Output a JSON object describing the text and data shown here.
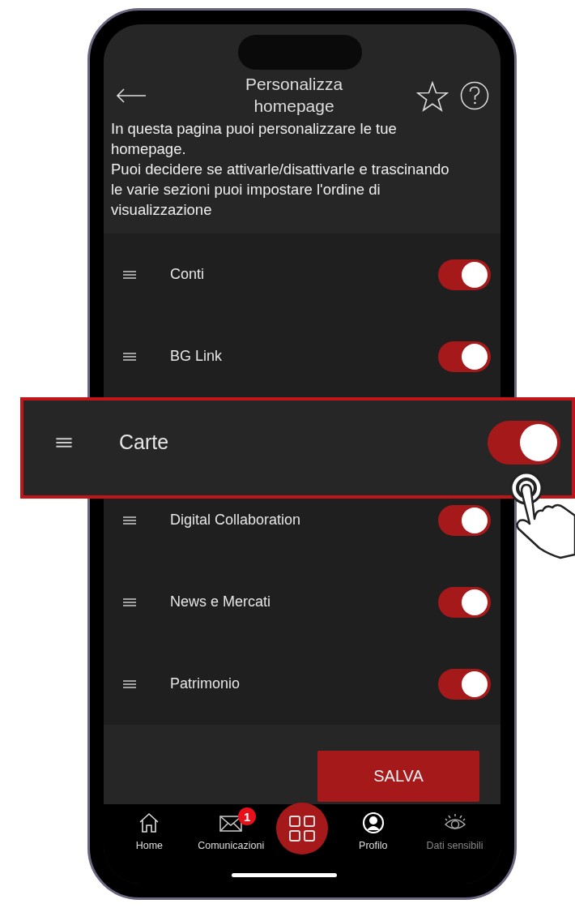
{
  "header": {
    "title": "Personalizza homepage",
    "description": "In questa pagina puoi personalizzare le tue homepage.\nPuoi decidere se attivarle/disattivarle e trascinando le varie sezioni puoi impostare l'ordine di visualizzazione"
  },
  "sections": [
    {
      "label": "Conti",
      "on": true,
      "highlighted": false
    },
    {
      "label": "BG Link",
      "on": true,
      "highlighted": false
    },
    {
      "label": "Carte",
      "on": true,
      "highlighted": true
    },
    {
      "label": "Digital Collaboration",
      "on": true,
      "highlighted": false
    },
    {
      "label": "News e Mercati",
      "on": true,
      "highlighted": false
    },
    {
      "label": "Patrimonio",
      "on": true,
      "highlighted": false
    }
  ],
  "save_button": "SALVA",
  "tab_bar": [
    {
      "kind": "home",
      "label": "Home",
      "disabled": false
    },
    {
      "kind": "mail",
      "label": "Comunicazioni",
      "badge": "1",
      "disabled": false
    },
    {
      "kind": "grid"
    },
    {
      "kind": "profile",
      "label": "Profilo",
      "disabled": false
    },
    {
      "kind": "eye",
      "label": "Dati sensibili",
      "disabled": true
    }
  ]
}
